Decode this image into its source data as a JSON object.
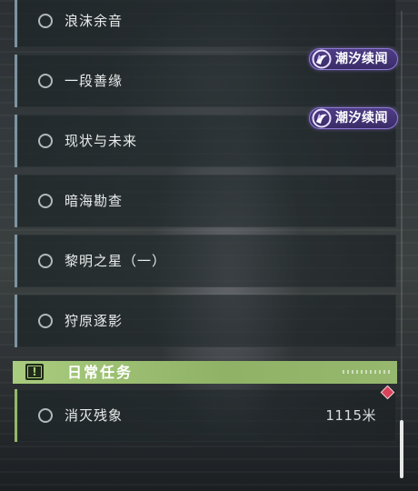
{
  "quests": [
    {
      "label": "浪沫余音"
    },
    {
      "label": "一段善缘"
    },
    {
      "label": "现状与未来"
    },
    {
      "label": "暗海勘查"
    },
    {
      "label": "黎明之星（一）"
    },
    {
      "label": "狩原逐影"
    }
  ],
  "badges": [
    {
      "text": "潮汐续闻"
    },
    {
      "text": "潮汐续闻"
    }
  ],
  "daily_section": {
    "title": "日常任务",
    "icon_glyph": "!"
  },
  "daily_quests": [
    {
      "label": "消灭残象",
      "distance": "1115米"
    }
  ],
  "colors": {
    "main_quest_accent": "#7d93a1",
    "daily_accent": "#a9cc7e",
    "badge_purple": "#4f3d86",
    "marker_red": "#d8435a"
  },
  "icons": {
    "quest_status": "radio-circle-icon",
    "badge": "tidal-swirl-icon",
    "section": "exclamation-box-icon",
    "tracking": "diamond-marker-icon"
  }
}
